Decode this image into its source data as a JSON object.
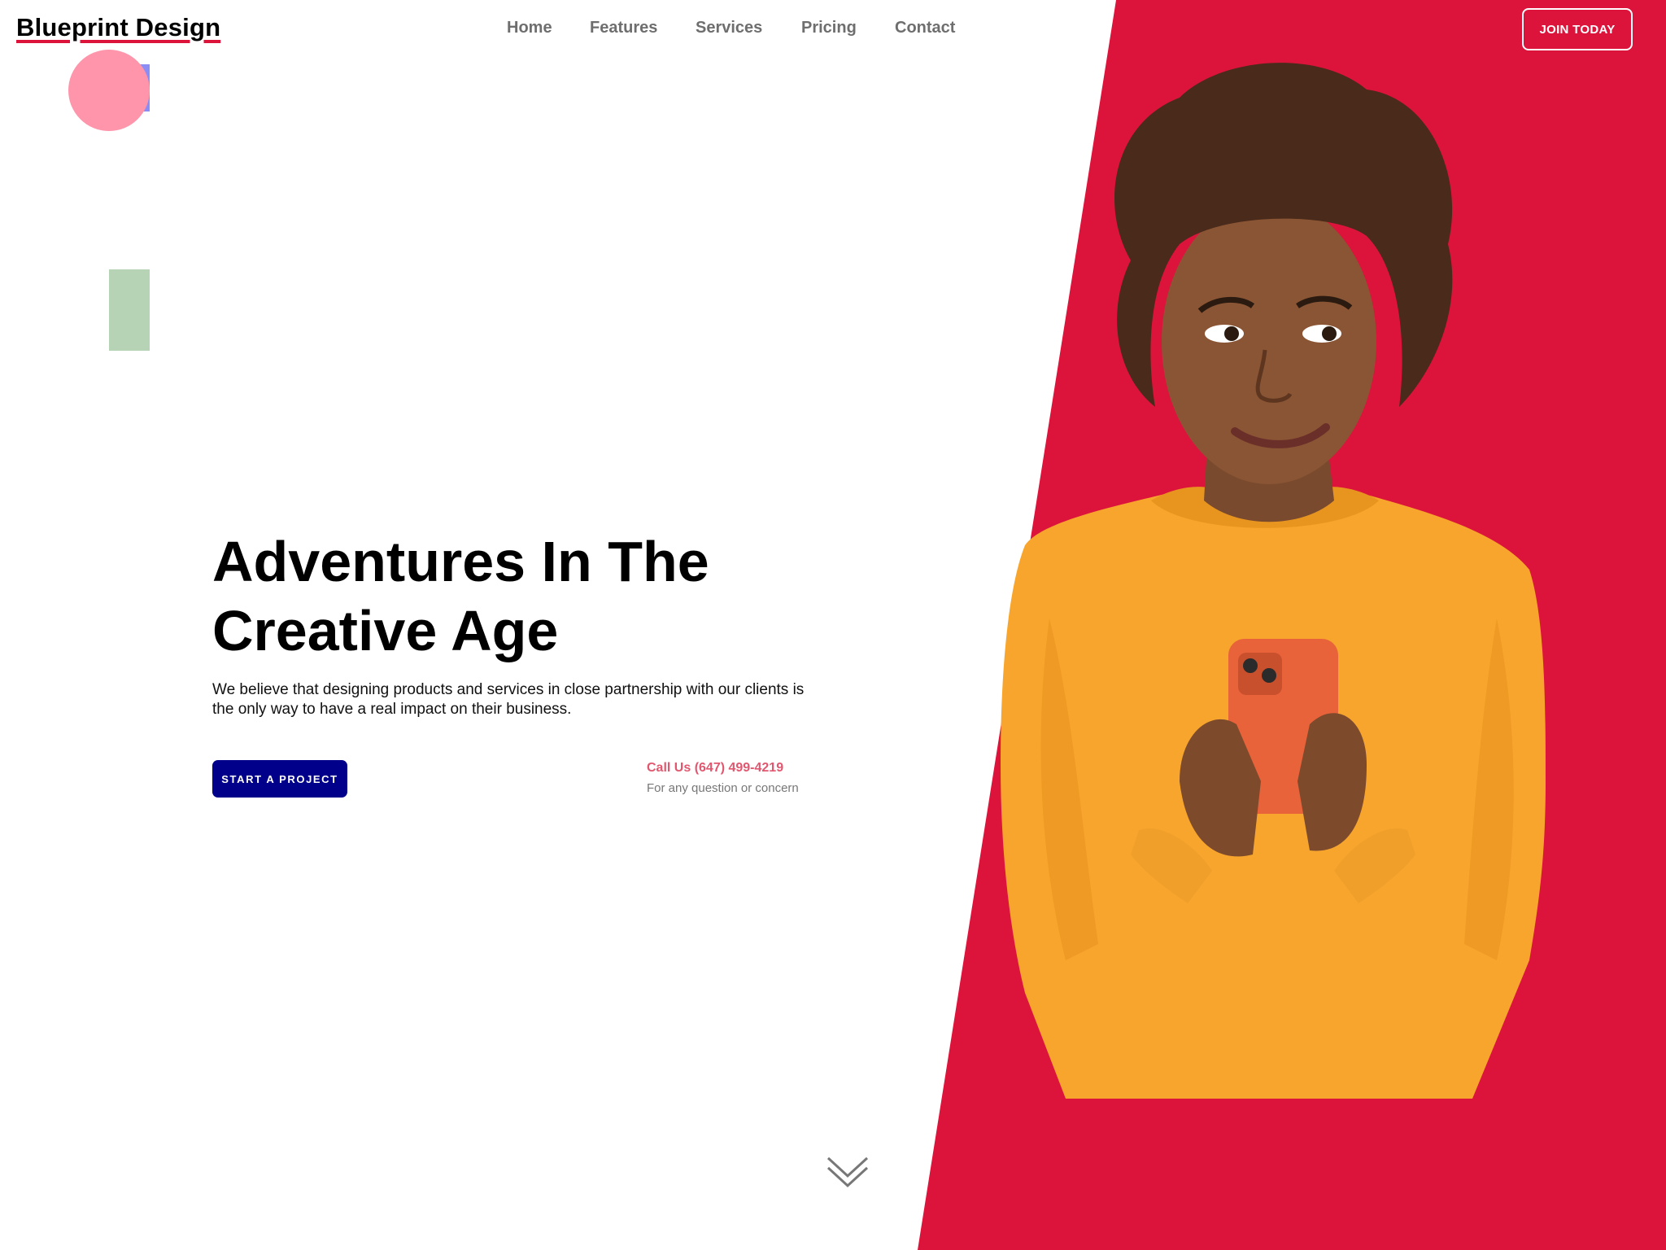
{
  "header": {
    "logo": "Blueprint Design",
    "nav": [
      "Home",
      "Features",
      "Services",
      "Pricing",
      "Contact"
    ],
    "cta": "JOIN TODAY"
  },
  "hero": {
    "title_line1": "Adventures In The",
    "title_line2": "Creative Age",
    "description": "We believe that designing products and services in close partnership with our clients is the only way to have a real impact on their business.",
    "primary_button": "START A PROJECT",
    "call_label": "Call Us (647) 499-4219",
    "call_note": "For any question or concern"
  },
  "icons": {
    "scroll": "chevron-double-down-icon"
  },
  "colors": {
    "accent_red": "#dc143c",
    "primary_blue": "#00008b",
    "call_pink": "#e0576f",
    "deco_circle": "#ff95ab",
    "deco_square": "#8c8cf5",
    "deco_bar": "#b7d3b6",
    "sweater": "#f7a52c",
    "phone": "#e8623a"
  }
}
